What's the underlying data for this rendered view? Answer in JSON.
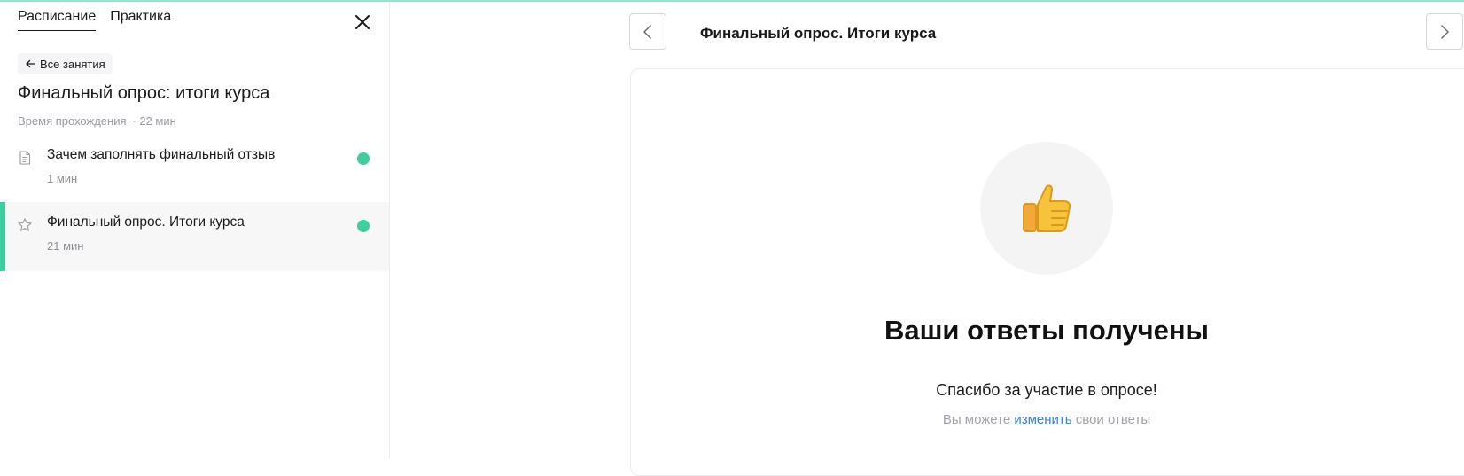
{
  "tabs": [
    {
      "label": "Расписание",
      "active": true
    },
    {
      "label": "Практика",
      "active": false
    }
  ],
  "sidebar": {
    "back_label": "Все занятия",
    "course_title": "Финальный опрос: итоги курса",
    "course_time": "Время прохождения ~ 22 мин",
    "lessons": [
      {
        "title": "Зачем заполнять финальный отзыв",
        "duration": "1 мин",
        "icon": "document-icon",
        "status": "completed",
        "active": false
      },
      {
        "title": "Финальный опрос. Итоги курса",
        "duration": "21 мин",
        "icon": "star-icon",
        "status": "completed",
        "active": true
      }
    ]
  },
  "header": {
    "title": "Финальный опрос. Итоги курса"
  },
  "result": {
    "emoji": "👍",
    "title": "Ваши ответы получены",
    "thanks": "Спасибо за участие в опросе!",
    "change_prefix": "Вы можете ",
    "change_link": "изменить",
    "change_suffix": " свои ответы"
  },
  "colors": {
    "accent": "#3fcf9f",
    "link": "#3d7fd6",
    "muted": "#9a9aa3"
  }
}
